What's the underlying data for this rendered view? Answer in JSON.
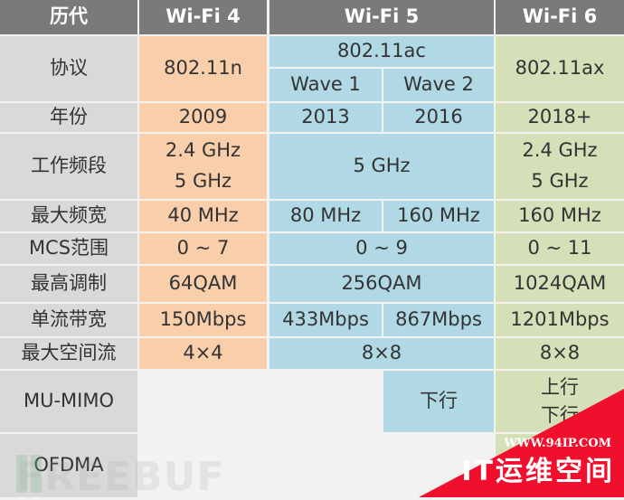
{
  "table": {
    "header": {
      "label": "历代",
      "wifi4": "Wi-Fi 4",
      "wifi5": "Wi-Fi 5",
      "wifi6": "Wi-Fi 6"
    },
    "rows": {
      "protocol": {
        "label": "协议",
        "wifi4": "802.11n",
        "wifi5": "802.11ac",
        "wifi5_wave1": "Wave 1",
        "wifi5_wave2": "Wave 2",
        "wifi6": "802.11ax"
      },
      "year": {
        "label": "年份",
        "wifi4": "2009",
        "wifi5_wave1": "2013",
        "wifi5_wave2": "2016",
        "wifi6": "2018+"
      },
      "band": {
        "label": "工作频段",
        "wifi4": "2.4 GHz\n5 GHz",
        "wifi5": "5 GHz",
        "wifi6": "2.4 GHz\n5 GHz"
      },
      "max_width": {
        "label": "最大频宽",
        "wifi4": "40 MHz",
        "wifi5_wave1": "80 MHz",
        "wifi5_wave2": "160 MHz",
        "wifi6": "160 MHz"
      },
      "mcs": {
        "label": "MCS范围",
        "wifi4": "0 ~ 7",
        "wifi5": "0 ~ 9",
        "wifi6": "0 ~ 11"
      },
      "modulation": {
        "label": "最高调制",
        "wifi4": "64QAM",
        "wifi5": "256QAM",
        "wifi6": "1024QAM"
      },
      "stream_rate": {
        "label": "单流带宽",
        "wifi4": "150Mbps",
        "wifi5_wave1": "433Mbps",
        "wifi5_wave2": "867Mbps",
        "wifi6": "1201Mbps"
      },
      "spatial": {
        "label": "最大空间流",
        "wifi4": "4×4",
        "wifi5": "8×8",
        "wifi6": "8×8"
      },
      "mumimo": {
        "label": "MU-MIMO",
        "wifi5_wave2": "下行",
        "wifi6": "上行\n下行"
      },
      "ofdma": {
        "label": "OFDMA"
      }
    }
  },
  "watermarks": {
    "freebuf": "FREEBUF",
    "site_url": "WWW.94IP.COM",
    "site_name": "IT运维空间"
  },
  "colors": {
    "header": "#7a7a7a",
    "label": "#d9d9d9",
    "wifi4": "#f9cfab",
    "wifi5": "#b0d9e5",
    "wifi6": "#d5dfb8",
    "corner": "#f0102e"
  }
}
